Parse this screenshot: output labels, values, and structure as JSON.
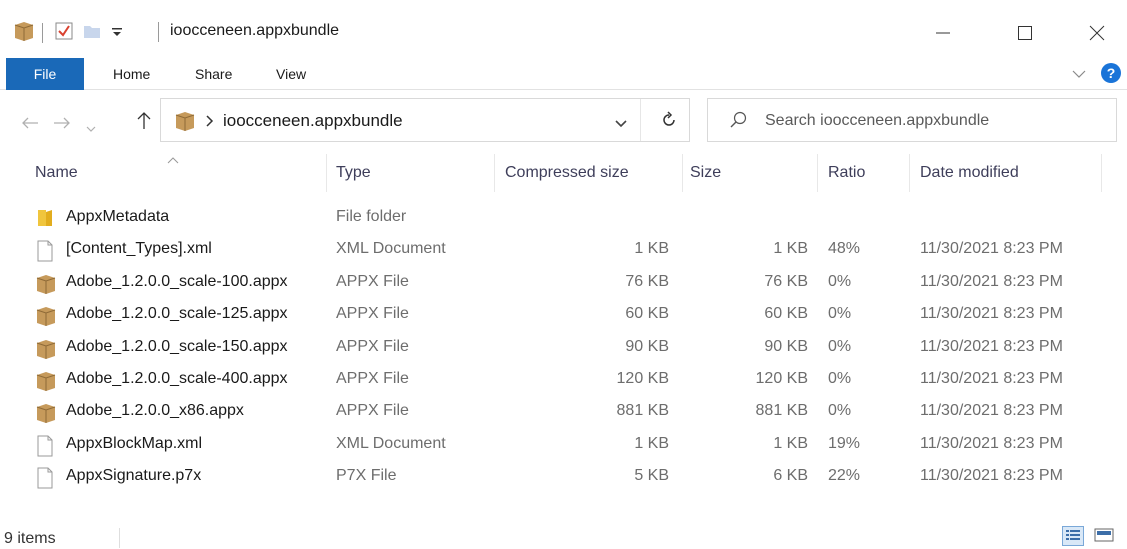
{
  "window": {
    "title": "ioocceneen.appxbundle"
  },
  "ribbon": {
    "tabs": [
      "File",
      "Home",
      "Share",
      "View"
    ]
  },
  "address": {
    "path": "ioocceneen.appxbundle",
    "search_placeholder": "Search ioocceneen.appxbundle"
  },
  "columns": {
    "name": "Name",
    "type": "Type",
    "compressed": "Compressed size",
    "size": "Size",
    "ratio": "Ratio",
    "date": "Date modified"
  },
  "files": [
    {
      "icon": "folder-icon",
      "name": "AppxMetadata",
      "type": "File folder",
      "compressed": "",
      "size": "",
      "ratio": "",
      "date": ""
    },
    {
      "icon": "document-icon",
      "name": "[Content_Types].xml",
      "type": "XML Document",
      "compressed": "1 KB",
      "size": "1 KB",
      "ratio": "48%",
      "date": "11/30/2021 8:23 PM"
    },
    {
      "icon": "package-icon",
      "name": "Adobe_1.2.0.0_scale-100.appx",
      "type": "APPX File",
      "compressed": "76 KB",
      "size": "76 KB",
      "ratio": "0%",
      "date": "11/30/2021 8:23 PM"
    },
    {
      "icon": "package-icon",
      "name": "Adobe_1.2.0.0_scale-125.appx",
      "type": "APPX File",
      "compressed": "60 KB",
      "size": "60 KB",
      "ratio": "0%",
      "date": "11/30/2021 8:23 PM"
    },
    {
      "icon": "package-icon",
      "name": "Adobe_1.2.0.0_scale-150.appx",
      "type": "APPX File",
      "compressed": "90 KB",
      "size": "90 KB",
      "ratio": "0%",
      "date": "11/30/2021 8:23 PM"
    },
    {
      "icon": "package-icon",
      "name": "Adobe_1.2.0.0_scale-400.appx",
      "type": "APPX File",
      "compressed": "120 KB",
      "size": "120 KB",
      "ratio": "0%",
      "date": "11/30/2021 8:23 PM"
    },
    {
      "icon": "package-icon",
      "name": "Adobe_1.2.0.0_x86.appx",
      "type": "APPX File",
      "compressed": "881 KB",
      "size": "881 KB",
      "ratio": "0%",
      "date": "11/30/2021 8:23 PM"
    },
    {
      "icon": "document-icon",
      "name": "AppxBlockMap.xml",
      "type": "XML Document",
      "compressed": "1 KB",
      "size": "1 KB",
      "ratio": "19%",
      "date": "11/30/2021 8:23 PM"
    },
    {
      "icon": "document-icon",
      "name": "AppxSignature.p7x",
      "type": "P7X File",
      "compressed": "5 KB",
      "size": "6 KB",
      "ratio": "22%",
      "date": "11/30/2021 8:23 PM"
    }
  ],
  "status": {
    "item_count": "9 items"
  },
  "colors": {
    "accent": "#1a69b8",
    "help": "#1a74d8",
    "folder": "#f0c53d",
    "package": "#c69a5b"
  }
}
